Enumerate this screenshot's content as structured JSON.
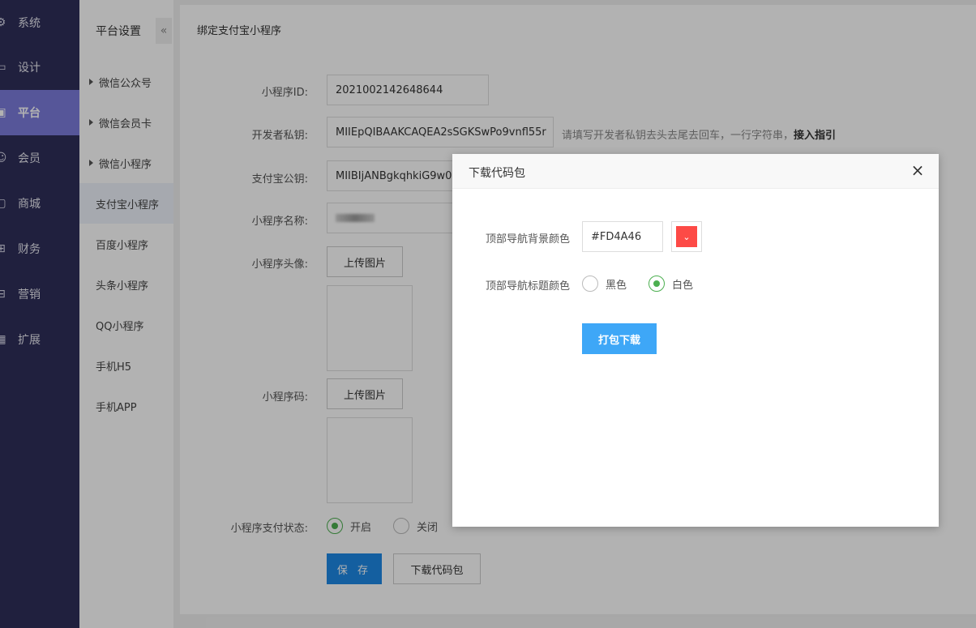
{
  "leftnav": {
    "items": [
      {
        "label": "系统",
        "icon": "gear-icon"
      },
      {
        "label": "设计",
        "icon": "monitor-icon"
      },
      {
        "label": "平台",
        "icon": "platform-icon"
      },
      {
        "label": "会员",
        "icon": "user-icon"
      },
      {
        "label": "商城",
        "icon": "mall-icon"
      },
      {
        "label": "财务",
        "icon": "finance-icon"
      },
      {
        "label": "营销",
        "icon": "gift-icon"
      },
      {
        "label": "扩展",
        "icon": "grid-icon"
      }
    ],
    "active_index": 2
  },
  "subnav": {
    "title": "平台设置",
    "collapse_glyph": "«",
    "items": [
      {
        "label": "微信公众号"
      },
      {
        "label": "微信会员卡"
      },
      {
        "label": "微信小程序"
      },
      {
        "label": "支付宝小程序"
      },
      {
        "label": "百度小程序"
      },
      {
        "label": "头条小程序"
      },
      {
        "label": "QQ小程序"
      },
      {
        "label": "手机H5"
      },
      {
        "label": "手机APP"
      }
    ],
    "active_index": 3
  },
  "main": {
    "title": "绑定支付宝小程序",
    "form": {
      "app_id_label": "小程序ID:",
      "app_id_value": "2021002142648644",
      "private_key_label": "开发者私钥:",
      "private_key_value": "MIIEpQIBAAKCAQEA2sSGKSwPo9vnfl55r",
      "private_key_hint": "请填写开发者私钥去头去尾去回车，一行字符串，",
      "private_key_guide": "接入指引",
      "public_key_label": "支付宝公钥:",
      "public_key_value": "MIIBIjANBgkqhkiG9w0B",
      "name_label": "小程序名称:",
      "avatar_label": "小程序头像:",
      "upload_label": "上传图片",
      "qrcode_label": "小程序码:",
      "pay_status_label": "小程序支付状态:",
      "pay_on": "开启",
      "pay_off": "关闭",
      "save_label": "保 存",
      "download_label": "下载代码包"
    }
  },
  "modal": {
    "title": "下载代码包",
    "close_glyph": "×",
    "bg_color_label": "顶部导航背景颜色",
    "bg_color_value": "#FD4A46",
    "title_color_label": "顶部导航标题颜色",
    "opt_black": "黑色",
    "opt_white": "白色",
    "selected": "白色",
    "pack_label": "打包下载",
    "picker_glyph": "⌄"
  },
  "colors": {
    "nav_bg": "#2f2f5a",
    "nav_active": "#7b7bdc",
    "primary": "#1e88e5",
    "pack_button": "#3ea7f7",
    "swatch": "#FD4A46",
    "radio_on": "#4caf50"
  }
}
